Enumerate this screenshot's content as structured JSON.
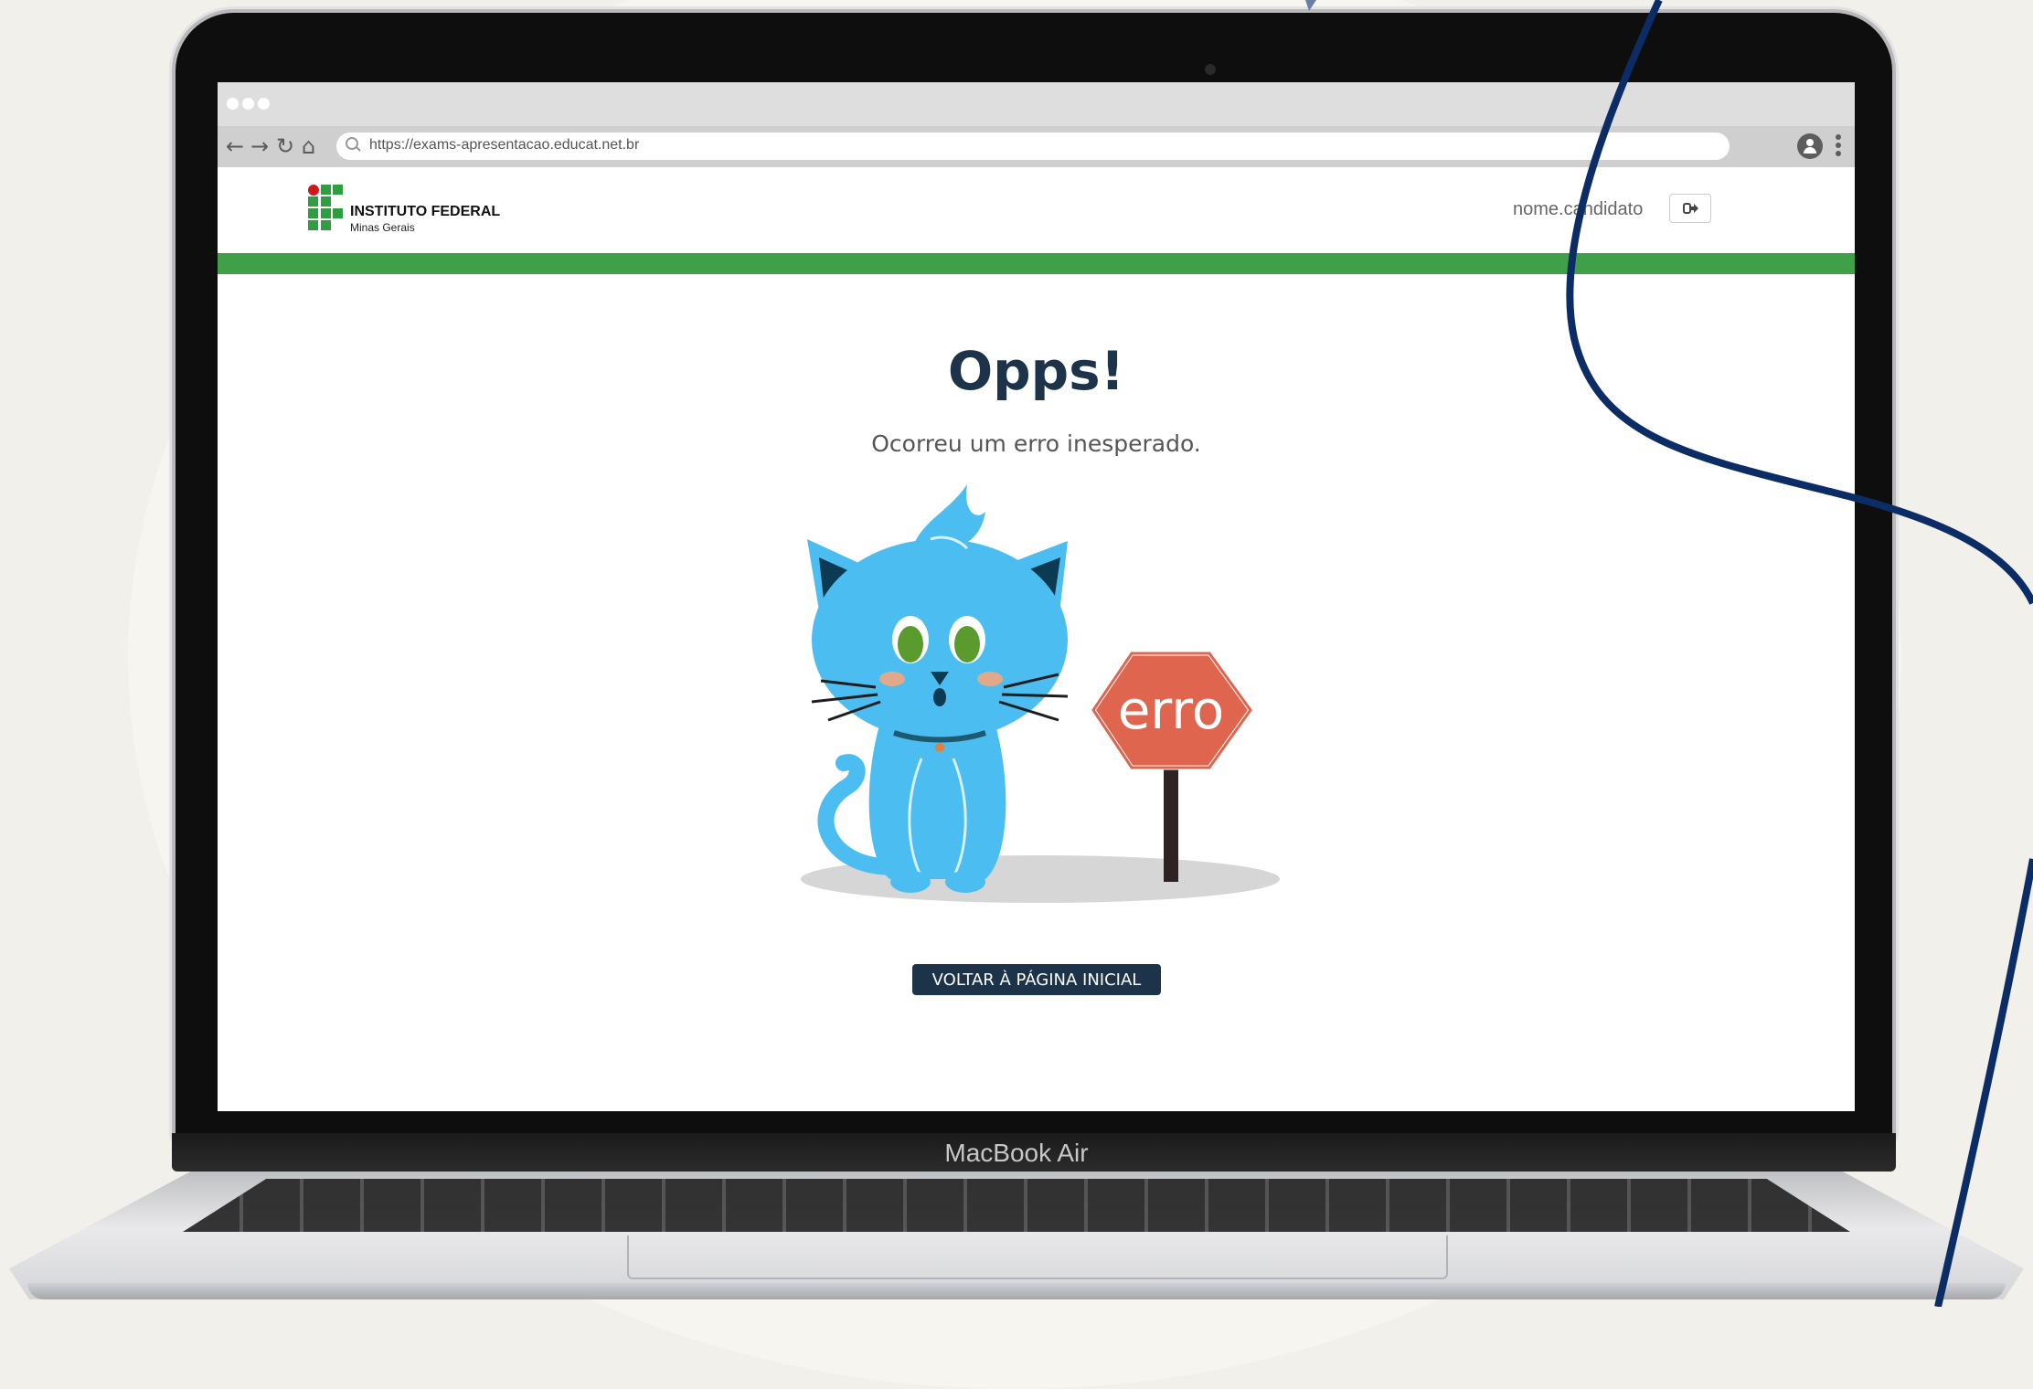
{
  "device": {
    "label": "MacBook Air"
  },
  "browser": {
    "url": "https://exams-apresentacao.educat.net.br",
    "nav": {
      "back_icon": "arrow-left-icon",
      "forward_icon": "arrow-right-icon",
      "reload_icon": "reload-icon",
      "home_icon": "home-icon"
    }
  },
  "site": {
    "logo": {
      "name": "INSTITUTO FEDERAL",
      "subtitle": "Minas Gerais"
    },
    "user": {
      "name": "nome.candidato",
      "logout_icon": "sign-out-icon"
    }
  },
  "error_page": {
    "title": "Opps!",
    "message": "Ocorreu um erro inesperado.",
    "sign_text": "erro",
    "button_label": "VOLTAR À PÁGINA INICIAL"
  },
  "colors": {
    "brand_green": "#40a048",
    "navy": "#1c3349",
    "cat_blue": "#4cbdf0",
    "sign_red": "#e0654f"
  }
}
